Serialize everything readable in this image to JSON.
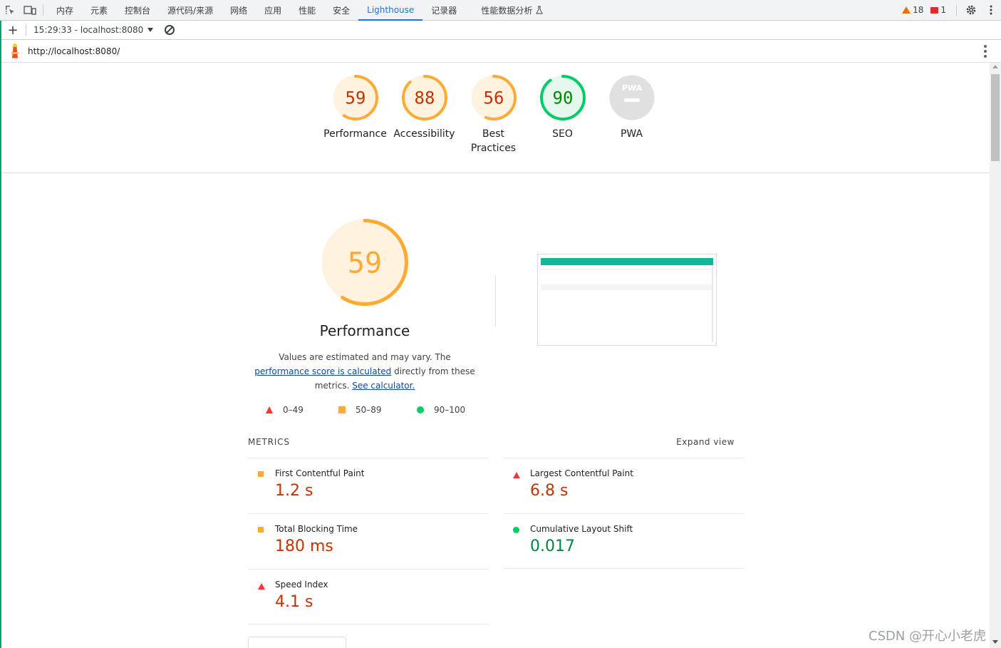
{
  "devtools": {
    "tabs": [
      {
        "label": "内存"
      },
      {
        "label": "元素"
      },
      {
        "label": "控制台"
      },
      {
        "label": "源代码/来源"
      },
      {
        "label": "网络"
      },
      {
        "label": "应用"
      },
      {
        "label": "性能"
      },
      {
        "label": "安全"
      },
      {
        "label": "Lighthouse",
        "active": true
      },
      {
        "label": "记录器"
      },
      {
        "label": "性能数据分析"
      }
    ],
    "warnings_count": "18",
    "errors_count": "1"
  },
  "toolbar": {
    "report_label": "15:29:33 - localhost:8080"
  },
  "url": "http://localhost:8080/",
  "gauges": [
    {
      "score": "59",
      "label": "Performance",
      "fraction": 0.59,
      "color": "#fa3",
      "text_color": "#c33300",
      "fill": "#fff3e0"
    },
    {
      "score": "88",
      "label": "Accessibility",
      "fraction": 0.88,
      "color": "#fa3",
      "text_color": "#c33300",
      "fill": "#fff3e0"
    },
    {
      "score": "56",
      "label": "Best Practices",
      "fraction": 0.56,
      "color": "#fa3",
      "text_color": "#c33300",
      "fill": "#fff3e0"
    },
    {
      "score": "90",
      "label": "SEO",
      "fraction": 0.9,
      "color": "#0c6",
      "text_color": "#008800",
      "fill": "#e6f8ee"
    },
    {
      "score": "PWA",
      "label": "PWA",
      "fraction": 0,
      "color": "#9e9e9e",
      "text_color": "#ffffff",
      "fill": "#e0e0e0"
    }
  ],
  "performance": {
    "score": "59",
    "fraction": 0.59,
    "title": "Performance",
    "desc_pre": "Values are estimated and may vary. The ",
    "desc_link1": "performance score is calculated",
    "desc_mid": " directly from these metrics. ",
    "desc_link2": "See calculator.",
    "legend": [
      {
        "shape": "triangle",
        "range": "0–49"
      },
      {
        "shape": "square",
        "range": "50–89"
      },
      {
        "shape": "circle",
        "range": "90–100"
      }
    ]
  },
  "metrics": {
    "header": "METRICS",
    "expand_label": "Expand view",
    "items": [
      {
        "name": "First Contentful Paint",
        "value": "1.2 s",
        "rating": "average"
      },
      {
        "name": "Largest Contentful Paint",
        "value": "6.8 s",
        "rating": "fail"
      },
      {
        "name": "Total Blocking Time",
        "value": "180 ms",
        "rating": "average"
      },
      {
        "name": "Cumulative Layout Shift",
        "value": "0.017",
        "rating": "pass"
      },
      {
        "name": "Speed Index",
        "value": "4.1 s",
        "rating": "fail"
      }
    ]
  },
  "watermark": "CSDN @开心小老虎"
}
